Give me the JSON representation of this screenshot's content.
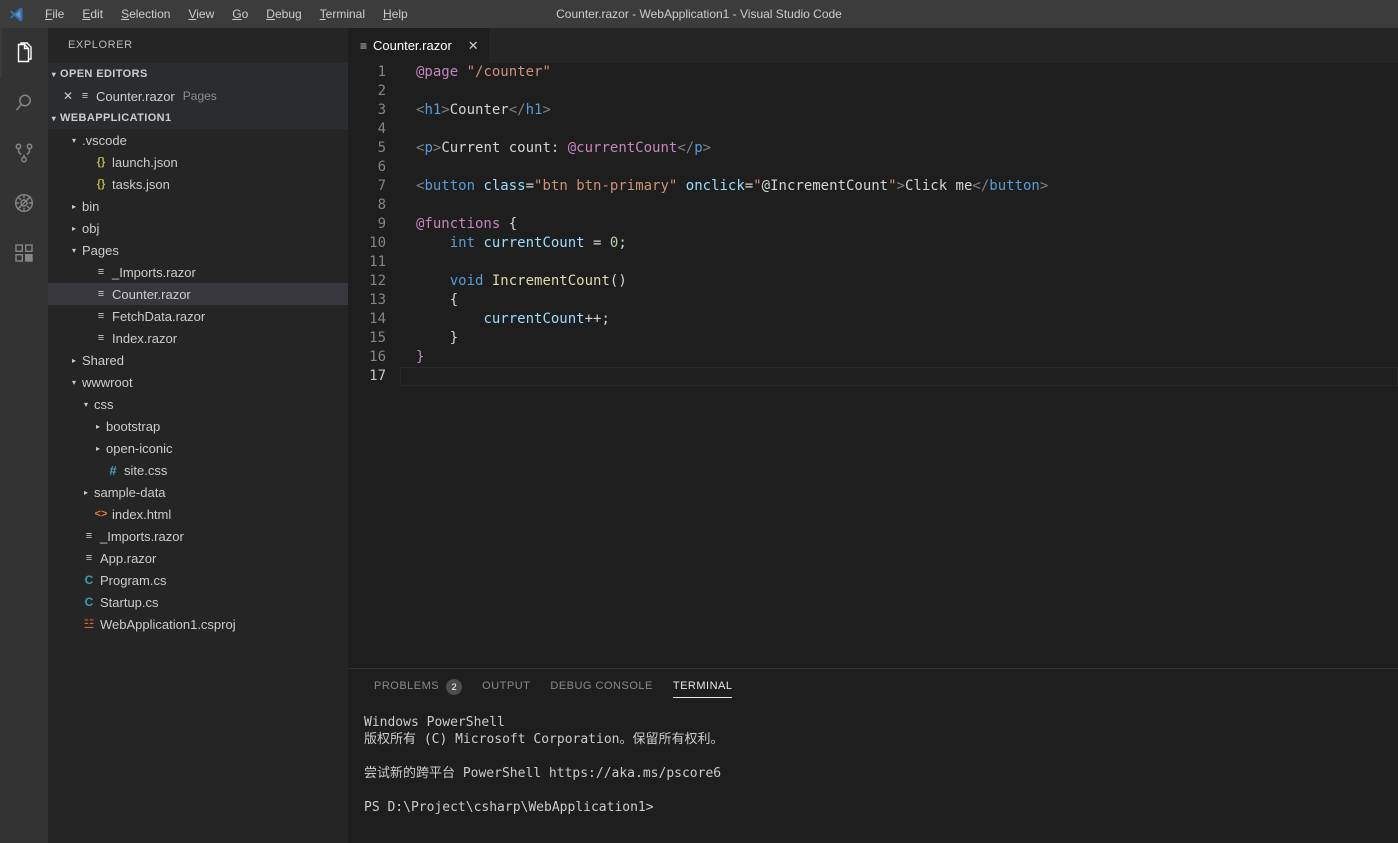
{
  "window": {
    "title": "Counter.razor - WebApplication1 - Visual Studio Code",
    "logo_icon": "vscode-logo-icon"
  },
  "menubar": {
    "items": [
      {
        "label": "File",
        "mnemonic": "F"
      },
      {
        "label": "Edit",
        "mnemonic": "E"
      },
      {
        "label": "Selection",
        "mnemonic": "S"
      },
      {
        "label": "View",
        "mnemonic": "V"
      },
      {
        "label": "Go",
        "mnemonic": "G"
      },
      {
        "label": "Debug",
        "mnemonic": "D"
      },
      {
        "label": "Terminal",
        "mnemonic": "T"
      },
      {
        "label": "Help",
        "mnemonic": "H"
      }
    ]
  },
  "activitybar": {
    "items": [
      {
        "name": "explorer-icon",
        "title": "Explorer",
        "active": true
      },
      {
        "name": "search-icon",
        "title": "Search",
        "active": false
      },
      {
        "name": "source-control-icon",
        "title": "Source Control",
        "active": false
      },
      {
        "name": "run-debug-icon",
        "title": "Debug",
        "active": false
      },
      {
        "name": "extensions-icon",
        "title": "Extensions",
        "active": false
      }
    ]
  },
  "sidebar": {
    "title": "EXPLORER",
    "open_editors": {
      "header": "OPEN EDITORS",
      "items": [
        {
          "label": "Counter.razor",
          "description": "Pages",
          "icon": "razor-file-icon",
          "close": "✕"
        }
      ]
    },
    "project": {
      "header": "WEBAPPLICATION1",
      "tree": [
        {
          "label": ".vscode",
          "indent": 1,
          "twisty": "open",
          "icon": "none",
          "selected": false
        },
        {
          "label": "launch.json",
          "indent": 2,
          "twisty": "blank",
          "icon": "json",
          "selected": false
        },
        {
          "label": "tasks.json",
          "indent": 2,
          "twisty": "blank",
          "icon": "json",
          "selected": false
        },
        {
          "label": "bin",
          "indent": 1,
          "twisty": "closed",
          "icon": "none",
          "selected": false
        },
        {
          "label": "obj",
          "indent": 1,
          "twisty": "closed",
          "icon": "none",
          "selected": false
        },
        {
          "label": "Pages",
          "indent": 1,
          "twisty": "open",
          "icon": "none",
          "selected": false
        },
        {
          "label": "_Imports.razor",
          "indent": 2,
          "twisty": "blank",
          "icon": "razor",
          "selected": false
        },
        {
          "label": "Counter.razor",
          "indent": 2,
          "twisty": "blank",
          "icon": "razor",
          "selected": true
        },
        {
          "label": "FetchData.razor",
          "indent": 2,
          "twisty": "blank",
          "icon": "razor",
          "selected": false
        },
        {
          "label": "Index.razor",
          "indent": 2,
          "twisty": "blank",
          "icon": "razor",
          "selected": false
        },
        {
          "label": "Shared",
          "indent": 1,
          "twisty": "closed",
          "icon": "none",
          "selected": false
        },
        {
          "label": "wwwroot",
          "indent": 1,
          "twisty": "open",
          "icon": "none",
          "selected": false
        },
        {
          "label": "css",
          "indent": 2,
          "twisty": "open",
          "icon": "none",
          "selected": false
        },
        {
          "label": "bootstrap",
          "indent": 3,
          "twisty": "closed",
          "icon": "none",
          "selected": false
        },
        {
          "label": "open-iconic",
          "indent": 3,
          "twisty": "closed",
          "icon": "none",
          "selected": false
        },
        {
          "label": "site.css",
          "indent": 3,
          "twisty": "blank",
          "icon": "css",
          "selected": false
        },
        {
          "label": "sample-data",
          "indent": 2,
          "twisty": "closed",
          "icon": "none",
          "selected": false
        },
        {
          "label": "index.html",
          "indent": 2,
          "twisty": "blank",
          "icon": "html",
          "selected": false
        },
        {
          "label": "_Imports.razor",
          "indent": 1,
          "twisty": "blank",
          "icon": "razor",
          "selected": false
        },
        {
          "label": "App.razor",
          "indent": 1,
          "twisty": "blank",
          "icon": "razor",
          "selected": false
        },
        {
          "label": "Program.cs",
          "indent": 1,
          "twisty": "blank",
          "icon": "cs",
          "selected": false
        },
        {
          "label": "Startup.cs",
          "indent": 1,
          "twisty": "blank",
          "icon": "cs",
          "selected": false
        },
        {
          "label": "WebApplication1.csproj",
          "indent": 1,
          "twisty": "blank",
          "icon": "csproj",
          "selected": false
        }
      ]
    }
  },
  "editor": {
    "tabs": [
      {
        "label": "Counter.razor",
        "icon": "razor-file-icon",
        "close_label": "✕",
        "active": true
      }
    ],
    "current_line": 17,
    "lines": [
      {
        "n": 1,
        "tokens": [
          {
            "t": "razor",
            "s": "@page"
          },
          {
            "t": "plain",
            "s": " "
          },
          {
            "t": "string",
            "s": "\"/counter\""
          }
        ]
      },
      {
        "n": 2,
        "tokens": []
      },
      {
        "n": 3,
        "tokens": [
          {
            "t": "brk",
            "s": "<"
          },
          {
            "t": "tag",
            "s": "h1"
          },
          {
            "t": "brk",
            "s": ">"
          },
          {
            "t": "plain",
            "s": "Counter"
          },
          {
            "t": "brk",
            "s": "</"
          },
          {
            "t": "tag",
            "s": "h1"
          },
          {
            "t": "brk",
            "s": ">"
          }
        ]
      },
      {
        "n": 4,
        "tokens": []
      },
      {
        "n": 5,
        "tokens": [
          {
            "t": "brk",
            "s": "<"
          },
          {
            "t": "tag",
            "s": "p"
          },
          {
            "t": "brk",
            "s": ">"
          },
          {
            "t": "plain",
            "s": "Current count: "
          },
          {
            "t": "razor",
            "s": "@currentCount"
          },
          {
            "t": "brk",
            "s": "</"
          },
          {
            "t": "tag",
            "s": "p"
          },
          {
            "t": "brk",
            "s": ">"
          }
        ]
      },
      {
        "n": 6,
        "tokens": []
      },
      {
        "n": 7,
        "tokens": [
          {
            "t": "brk",
            "s": "<"
          },
          {
            "t": "tag",
            "s": "button"
          },
          {
            "t": "plain",
            "s": " "
          },
          {
            "t": "attr",
            "s": "class"
          },
          {
            "t": "plain",
            "s": "="
          },
          {
            "t": "string",
            "s": "\"btn btn-primary\""
          },
          {
            "t": "plain",
            "s": " "
          },
          {
            "t": "attr",
            "s": "onclick"
          },
          {
            "t": "plain",
            "s": "="
          },
          {
            "t": "string",
            "s": "\""
          },
          {
            "t": "plain",
            "s": "@IncrementCount"
          },
          {
            "t": "string",
            "s": "\""
          },
          {
            "t": "brk",
            "s": ">"
          },
          {
            "t": "plain",
            "s": "Click me"
          },
          {
            "t": "brk",
            "s": "</"
          },
          {
            "t": "tag",
            "s": "button"
          },
          {
            "t": "brk",
            "s": ">"
          }
        ]
      },
      {
        "n": 8,
        "tokens": []
      },
      {
        "n": 9,
        "tokens": [
          {
            "t": "razor",
            "s": "@functions"
          },
          {
            "t": "plain",
            "s": " "
          },
          {
            "t": "punc",
            "s": "{"
          }
        ]
      },
      {
        "n": 10,
        "tokens": [
          {
            "t": "plain",
            "s": "    "
          },
          {
            "t": "kw",
            "s": "int"
          },
          {
            "t": "plain",
            "s": " "
          },
          {
            "t": "var",
            "s": "currentCount"
          },
          {
            "t": "plain",
            "s": " = "
          },
          {
            "t": "num",
            "s": "0"
          },
          {
            "t": "punc",
            "s": ";"
          }
        ]
      },
      {
        "n": 11,
        "tokens": []
      },
      {
        "n": 12,
        "tokens": [
          {
            "t": "plain",
            "s": "    "
          },
          {
            "t": "kw",
            "s": "void"
          },
          {
            "t": "plain",
            "s": " "
          },
          {
            "t": "fn",
            "s": "IncrementCount"
          },
          {
            "t": "punc",
            "s": "()"
          }
        ]
      },
      {
        "n": 13,
        "tokens": [
          {
            "t": "plain",
            "s": "    "
          },
          {
            "t": "punc",
            "s": "{"
          }
        ]
      },
      {
        "n": 14,
        "tokens": [
          {
            "t": "plain",
            "s": "        "
          },
          {
            "t": "var",
            "s": "currentCount"
          },
          {
            "t": "punc",
            "s": "++;"
          }
        ]
      },
      {
        "n": 15,
        "tokens": [
          {
            "t": "plain",
            "s": "    "
          },
          {
            "t": "punc",
            "s": "}"
          }
        ]
      },
      {
        "n": 16,
        "tokens": [
          {
            "t": "razor",
            "s": "}"
          }
        ]
      },
      {
        "n": 17,
        "tokens": []
      }
    ]
  },
  "panel": {
    "tabs": [
      {
        "label": "PROBLEMS",
        "badge": "2",
        "active": false
      },
      {
        "label": "OUTPUT",
        "badge": null,
        "active": false
      },
      {
        "label": "DEBUG CONSOLE",
        "badge": null,
        "active": false
      },
      {
        "label": "TERMINAL",
        "badge": null,
        "active": true
      }
    ],
    "terminal_lines": [
      "Windows PowerShell",
      "版权所有 (C) Microsoft Corporation。保留所有权利。",
      "",
      "尝试新的跨平台 PowerShell https://aka.ms/pscore6",
      "",
      "PS D:\\Project\\csharp\\WebApplication1>"
    ]
  },
  "colors": {
    "titlebar_bg": "#3c3c3c",
    "activitybar_bg": "#333333",
    "sidebar_bg": "#252526",
    "editor_bg": "#1e1e1e",
    "selection_bg": "#37373d",
    "accent_razor": "#c586c0",
    "accent_string": "#ce9178",
    "accent_tag": "#569cd6"
  }
}
